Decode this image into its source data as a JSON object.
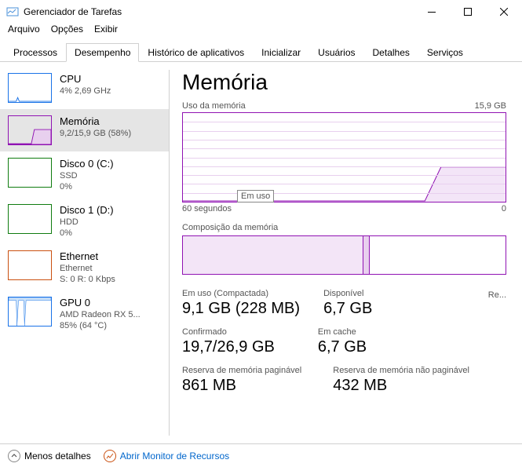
{
  "window": {
    "title": "Gerenciador de Tarefas"
  },
  "menu": {
    "file": "Arquivo",
    "options": "Opções",
    "view": "Exibir"
  },
  "tabs": {
    "processes": "Processos",
    "performance": "Desempenho",
    "apphistory": "Histórico de aplicativos",
    "startup": "Inicializar",
    "users": "Usuários",
    "details": "Detalhes",
    "services": "Serviços"
  },
  "sidebar": {
    "items": [
      {
        "title": "CPU",
        "sub1": "4% 2,69 GHz",
        "sub2": "",
        "color": "#1a73e8"
      },
      {
        "title": "Memória",
        "sub1": "9,2/15,9 GB (58%)",
        "sub2": "",
        "color": "#9013b3"
      },
      {
        "title": "Disco 0 (C:)",
        "sub1": "SSD",
        "sub2": "0%",
        "color": "#107c10"
      },
      {
        "title": "Disco 1 (D:)",
        "sub1": "HDD",
        "sub2": "0%",
        "color": "#107c10"
      },
      {
        "title": "Ethernet",
        "sub1": "Ethernet",
        "sub2": "S: 0 R: 0 Kbps",
        "color": "#ca5010"
      },
      {
        "title": "GPU 0",
        "sub1": "AMD Radeon RX 5...",
        "sub2": "85% (64 °C)",
        "color": "#1a73e8"
      }
    ]
  },
  "main": {
    "title": "Memória",
    "usage_label": "Uso da memória",
    "max_label": "15,9 GB",
    "x_left": "60 segundos",
    "x_right": "0",
    "tooltip": "Em uso",
    "composition_label": "Composição da memória",
    "stats": {
      "inuse_label": "Em uso (Compactada)",
      "inuse_value": "9,1 GB (228 MB)",
      "available_label": "Disponível",
      "available_value": "6,7 GB",
      "committed_label": "Confirmado",
      "committed_value": "19,7/26,9 GB",
      "cached_label": "Em cache",
      "cached_value": "6,7 GB",
      "paged_label": "Reserva de memória paginável",
      "paged_value": "861 MB",
      "nonpaged_label": "Reserva de memória não paginável",
      "nonpaged_value": "432 MB",
      "re": "Re..."
    }
  },
  "footer": {
    "fewer": "Menos detalhes",
    "monitor": "Abrir Monitor de Recursos"
  },
  "chart_data": {
    "type": "area",
    "title": "Uso da memória",
    "ylabel": "GB",
    "ylim": [
      0,
      15.9
    ],
    "xlim": [
      60,
      0
    ],
    "xlabel": "segundos",
    "series": [
      {
        "name": "Em uso",
        "values_approx": "flat ~0 from t=60..~15, then step up to ~6 GB from t=~15..0"
      }
    ],
    "composition": {
      "segments_pct": [
        56,
        2,
        42
      ],
      "segments": [
        "in_use",
        "modified",
        "standby_free"
      ]
    }
  }
}
